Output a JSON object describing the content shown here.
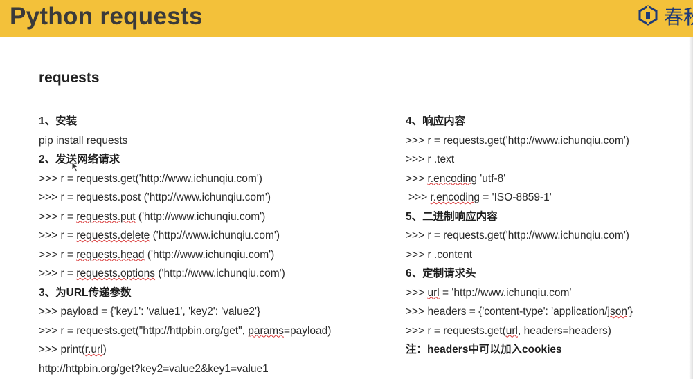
{
  "header": {
    "title": "Python requests",
    "logo_text": "春秋"
  },
  "section_title": "requests",
  "left_column": [
    {
      "type": "heading",
      "text": "1、安装"
    },
    {
      "type": "code",
      "parts": [
        {
          "t": "pip install requests"
        }
      ]
    },
    {
      "type": "heading",
      "text": "2、发送网络请求"
    },
    {
      "type": "code",
      "parts": [
        {
          "t": ">>> r = requests.get('http://www.ichunqiu.com')"
        }
      ]
    },
    {
      "type": "code",
      "parts": [
        {
          "t": ">>> r = requests.post ('http://www.ichunqiu.com')"
        }
      ]
    },
    {
      "type": "code",
      "parts": [
        {
          "t": ">>> r = "
        },
        {
          "t": "requests.put",
          "sq": true
        },
        {
          "t": " ('http://www.ichunqiu.com')"
        }
      ]
    },
    {
      "type": "code",
      "parts": [
        {
          "t": ">>> r = "
        },
        {
          "t": "requests.delete",
          "sq": true
        },
        {
          "t": " ('http://www.ichunqiu.com')"
        }
      ]
    },
    {
      "type": "code",
      "parts": [
        {
          "t": ">>> r = "
        },
        {
          "t": "requests.head",
          "sq": true
        },
        {
          "t": " ('http://www.ichunqiu.com')"
        }
      ]
    },
    {
      "type": "code",
      "parts": [
        {
          "t": ">>> r = "
        },
        {
          "t": "requests.options",
          "sq": true
        },
        {
          "t": " ('http://www.ichunqiu.com')"
        }
      ]
    },
    {
      "type": "heading",
      "text": "3、为URL传递参数"
    },
    {
      "type": "code",
      "parts": [
        {
          "t": ">>> payload = {'key1': 'value1', 'key2': 'value2'}"
        }
      ]
    },
    {
      "type": "code",
      "parts": [
        {
          "t": ">>> r = requests.get(\"http://httpbin.org/get\", "
        },
        {
          "t": "params",
          "sq": true
        },
        {
          "t": "=payload)"
        }
      ]
    },
    {
      "type": "code",
      "parts": [
        {
          "t": ">>> print("
        },
        {
          "t": "r.url",
          "sq": true
        },
        {
          "t": ")"
        }
      ]
    },
    {
      "type": "code",
      "parts": [
        {
          "t": "http://httpbin.org/get?key2=value2&key1=value1"
        }
      ]
    }
  ],
  "right_column": [
    {
      "type": "heading",
      "text": "4、响应内容"
    },
    {
      "type": "code",
      "parts": [
        {
          "t": ">>> r = requests.get('http://www.ichunqiu.com')"
        }
      ]
    },
    {
      "type": "code",
      "parts": [
        {
          "t": ">>> r .text"
        }
      ]
    },
    {
      "type": "code",
      "parts": [
        {
          "t": ">>> "
        },
        {
          "t": "r.encoding",
          "sq": true
        },
        {
          "t": " 'utf-8'"
        }
      ]
    },
    {
      "type": "code",
      "indent": true,
      "parts": [
        {
          "t": ">>> "
        },
        {
          "t": "r.encoding",
          "sq": true
        },
        {
          "t": " = 'ISO-8859-1'"
        }
      ]
    },
    {
      "type": "heading",
      "text": "5、二进制响应内容"
    },
    {
      "type": "code",
      "parts": [
        {
          "t": ">>> r = requests.get('http://www.ichunqiu.com')"
        }
      ]
    },
    {
      "type": "code",
      "parts": [
        {
          "t": ">>> r .content"
        }
      ]
    },
    {
      "type": "heading",
      "text": "6、定制请求头"
    },
    {
      "type": "code",
      "parts": [
        {
          "t": ">>> "
        },
        {
          "t": "url",
          "sq": true
        },
        {
          "t": " = 'http://www.ichunqiu.com'"
        }
      ]
    },
    {
      "type": "code",
      "parts": [
        {
          "t": ">>> headers = {'content-type': 'application/"
        },
        {
          "t": "json",
          "sq": true
        },
        {
          "t": "'}"
        }
      ]
    },
    {
      "type": "code",
      "parts": [
        {
          "t": ">>> r = requests.get("
        },
        {
          "t": "url",
          "sq": true
        },
        {
          "t": ", headers=headers)"
        }
      ]
    },
    {
      "type": "note",
      "text": "注：headers中可以加入cookies"
    }
  ],
  "colors": {
    "banner": "#f3c13a",
    "title": "#3a3a3a",
    "logo": "#1d3a78",
    "spell_underline": "#d93a3a"
  }
}
